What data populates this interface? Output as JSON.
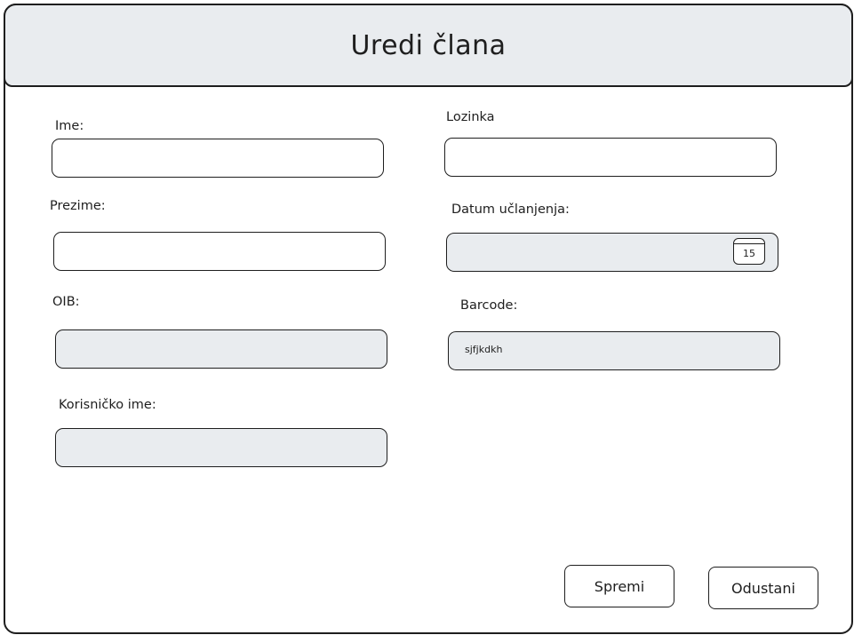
{
  "dialog": {
    "title": "Uredi člana"
  },
  "form": {
    "ime": {
      "label": "Ime:",
      "value": ""
    },
    "prezime": {
      "label": "Prezime:",
      "value": ""
    },
    "oib": {
      "label": "OIB:",
      "value": ""
    },
    "korisnicko_ime": {
      "label": "Korisničko ime:",
      "value": ""
    },
    "lozinka": {
      "label": "Lozinka",
      "value": ""
    },
    "datum": {
      "label": "Datum učlanjenja:",
      "value": "",
      "calendar_day": "15",
      "icon": "calendar-icon"
    },
    "barcode": {
      "label": "Barcode:",
      "value": "sjfjkdkh"
    }
  },
  "buttons": {
    "save": "Spremi",
    "cancel": "Odustani"
  },
  "colors": {
    "disabled_fill": "#e9ecef",
    "stroke": "#1e1e1e",
    "background": "#ffffff"
  }
}
